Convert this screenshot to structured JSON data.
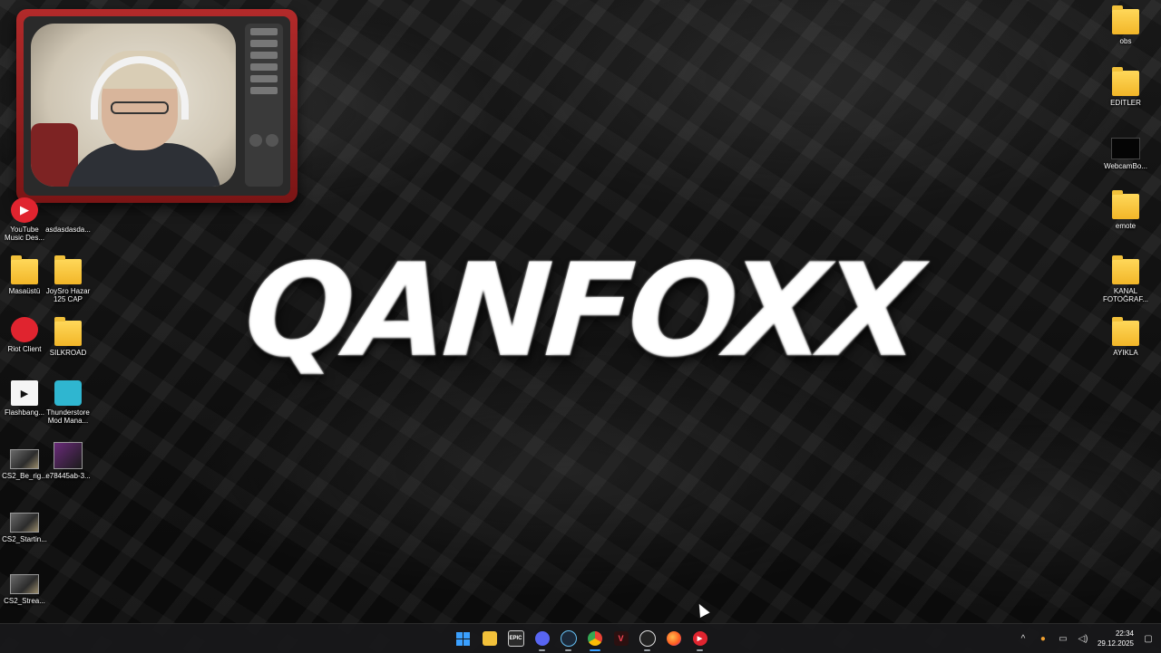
{
  "wallpaper": {
    "brand_text": "QANFOXX"
  },
  "desktop_icons_left": [
    {
      "label": "YouTube Music Des...",
      "icon": "youtube-music-icon"
    },
    {
      "label": "asdasdasda...",
      "icon": "app-icon"
    },
    {
      "label": "Masaüstü",
      "icon": "folder-icon"
    },
    {
      "label": "JoySro Hazar 125 CAP",
      "icon": "folder-icon"
    },
    {
      "label": "Riot Client",
      "icon": "riot-client-icon"
    },
    {
      "label": "SILKROAD",
      "icon": "folder-icon"
    },
    {
      "label": "Flashbang...",
      "icon": "media-icon"
    },
    {
      "label": "Thunderstore Mod Mana...",
      "icon": "thunderstore-icon"
    },
    {
      "label": "CS2_Be_rig...",
      "icon": "image-thumb-icon"
    },
    {
      "label": "e78445ab-3...",
      "icon": "image-thumb-icon"
    },
    {
      "label": "CS2_Startin...",
      "icon": "image-thumb-icon"
    },
    {
      "label": "CS2_Strea...",
      "icon": "image-thumb-icon"
    }
  ],
  "desktop_icons_right": [
    {
      "label": "obs",
      "icon": "folder-icon"
    },
    {
      "label": "EDITLER",
      "icon": "folder-icon"
    },
    {
      "label": "WebcamBo...",
      "icon": "image-thumb-icon"
    },
    {
      "label": "emote",
      "icon": "folder-icon"
    },
    {
      "label": "KANAL FOTOĞRAF...",
      "icon": "folder-icon"
    },
    {
      "label": "AYIKLA",
      "icon": "folder-icon"
    }
  ],
  "taskbar": {
    "apps": [
      {
        "name": "start",
        "icon": "windows-start-icon"
      },
      {
        "name": "file-explorer",
        "icon": "folder-icon",
        "glyph": ""
      },
      {
        "name": "epic-games",
        "icon": "epic-games-icon",
        "glyph": "EPIC"
      },
      {
        "name": "discord",
        "icon": "discord-icon",
        "glyph": ""
      },
      {
        "name": "steam",
        "icon": "steam-icon",
        "glyph": ""
      },
      {
        "name": "chrome",
        "icon": "chrome-icon",
        "glyph": ""
      },
      {
        "name": "valorant",
        "icon": "valorant-icon",
        "glyph": "V"
      },
      {
        "name": "obs",
        "icon": "obs-icon",
        "glyph": ""
      },
      {
        "name": "firefox",
        "icon": "firefox-icon",
        "glyph": ""
      },
      {
        "name": "youtube-music",
        "icon": "youtube-music-icon",
        "glyph": "▶"
      }
    ],
    "tray": {
      "chevron": "^",
      "time": "22:34",
      "date": "29.12.2025"
    }
  },
  "colors": {
    "accent": "#3aa0ff",
    "taskbar_bg": "#18181a"
  }
}
